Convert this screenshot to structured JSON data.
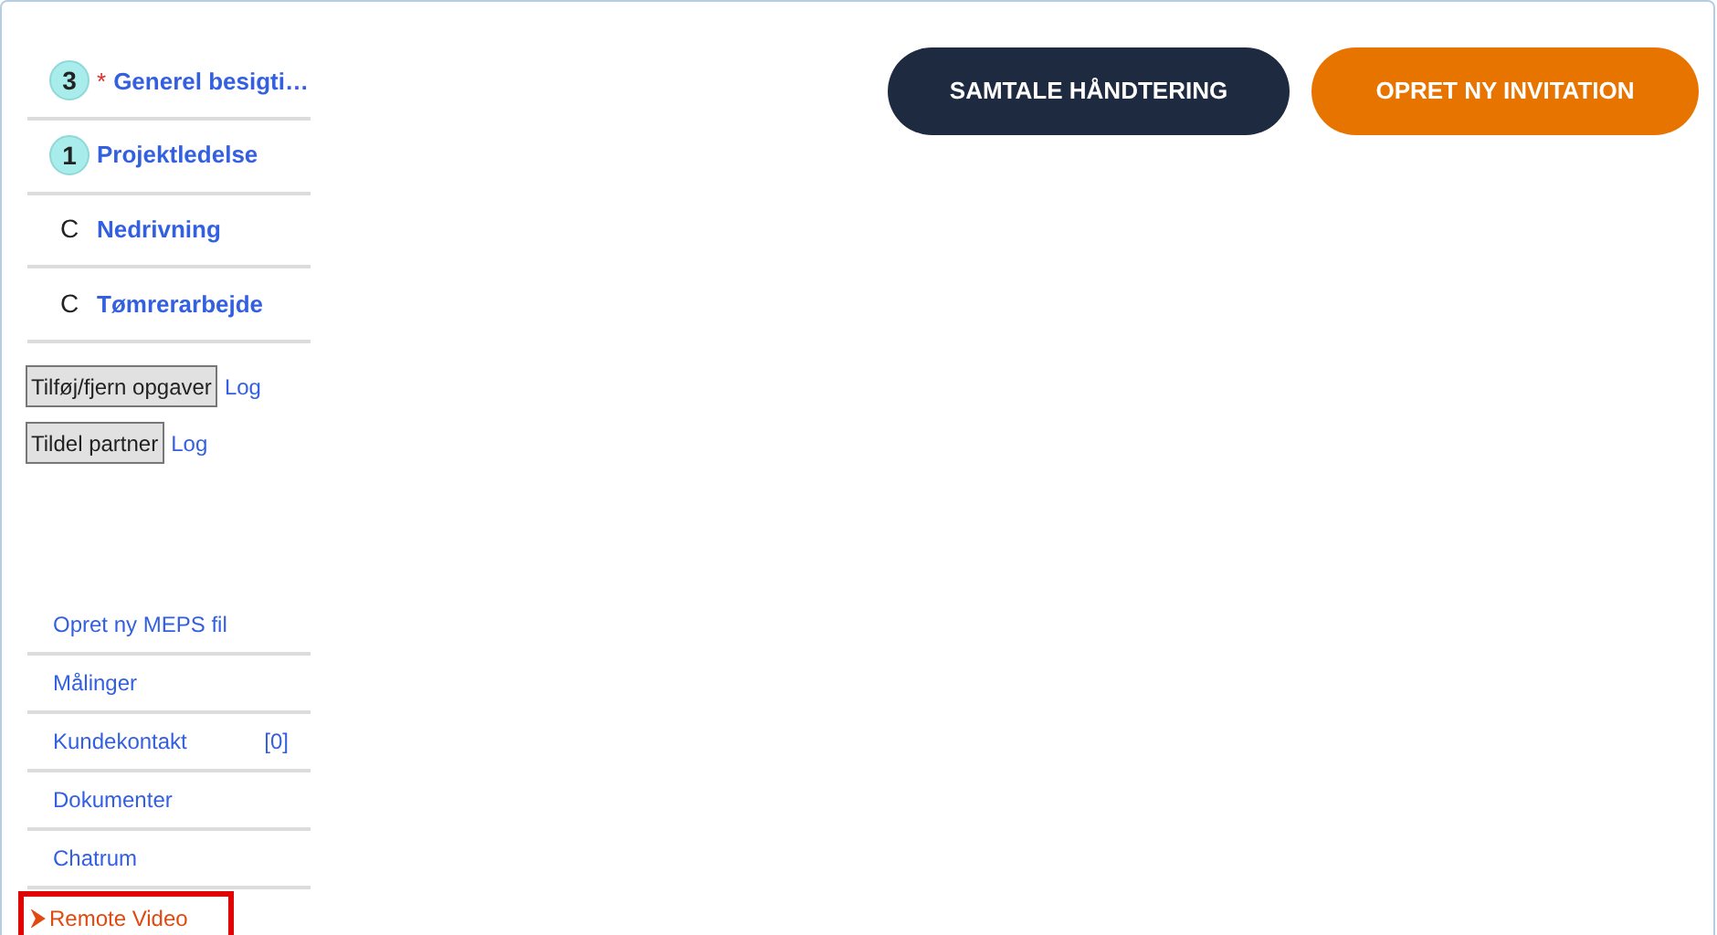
{
  "tasks": [
    {
      "kind": "badge",
      "marker": "3",
      "required": true,
      "label": "Generel besigti…"
    },
    {
      "kind": "badge",
      "marker": "1",
      "required": false,
      "label": "Projektledelse"
    },
    {
      "kind": "letter",
      "marker": "C",
      "required": false,
      "label": "Nedrivning"
    },
    {
      "kind": "letter",
      "marker": "C",
      "required": false,
      "label": "Tømrerarbejde"
    }
  ],
  "required_mark": "*",
  "actions": [
    {
      "button": "Tilføj/fjern opgaver",
      "link": "Log"
    },
    {
      "button": "Tildel partner",
      "link": "Log"
    }
  ],
  "menu": [
    {
      "label": "Opret ny MEPS fil",
      "selected": false
    },
    {
      "label": "Målinger",
      "selected": false
    },
    {
      "label": "Kundekontakt",
      "count": "[0]",
      "selected": false
    },
    {
      "label": "Dokumenter",
      "selected": false
    },
    {
      "label": "Chatrum",
      "selected": false
    },
    {
      "label": "Remote Video",
      "selected": true
    }
  ],
  "buttons": [
    {
      "label": "SAMTALE HÅNDTERING",
      "kind": "dark"
    },
    {
      "label": "OPRET NY INVITATION",
      "kind": "orange"
    }
  ]
}
